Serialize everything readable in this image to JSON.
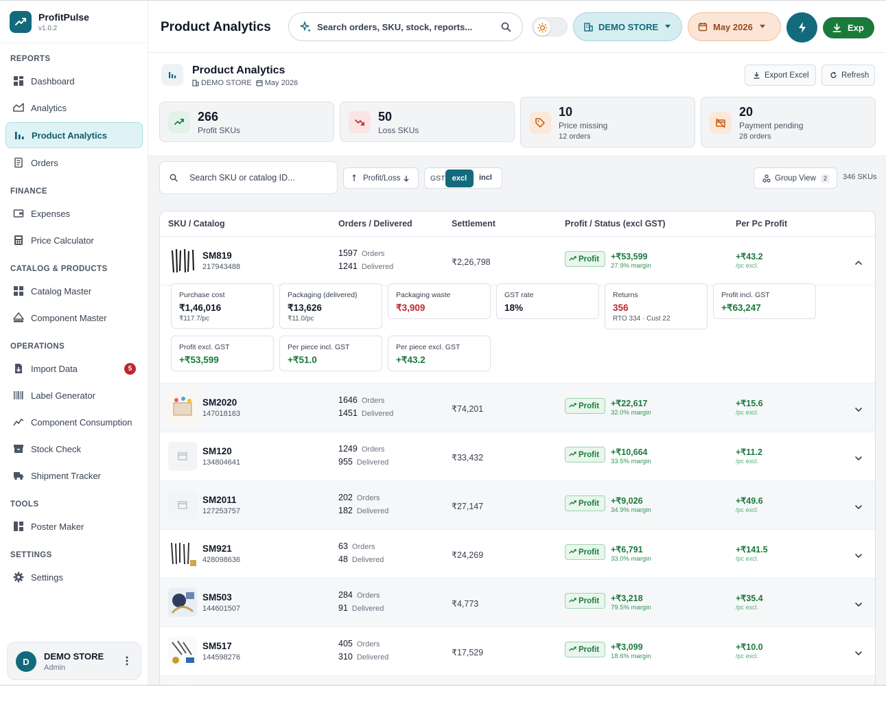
{
  "app": {
    "name": "ProfitPulse",
    "version": "v1.0.2"
  },
  "sidebar": {
    "sections": [
      {
        "title": "REPORTS",
        "items": [
          {
            "label": "Dashboard",
            "icon": "dashboard-icon"
          },
          {
            "label": "Analytics",
            "icon": "analytics-icon"
          },
          {
            "label": "Product Analytics",
            "icon": "bar-chart-icon",
            "active": true
          },
          {
            "label": "Orders",
            "icon": "orders-icon"
          }
        ]
      },
      {
        "title": "FINANCE",
        "items": [
          {
            "label": "Expenses",
            "icon": "wallet-icon"
          },
          {
            "label": "Price Calculator",
            "icon": "calculator-icon"
          }
        ]
      },
      {
        "title": "CATALOG & PRODUCTS",
        "items": [
          {
            "label": "Catalog Master",
            "icon": "grid-icon"
          },
          {
            "label": "Component Master",
            "icon": "layers-icon"
          }
        ]
      },
      {
        "title": "OPERATIONS",
        "items": [
          {
            "label": "Import Data",
            "icon": "file-icon",
            "badge": "5"
          },
          {
            "label": "Label Generator",
            "icon": "barcode-icon"
          },
          {
            "label": "Component Consumption",
            "icon": "trend-icon"
          },
          {
            "label": "Stock Check",
            "icon": "archive-icon"
          },
          {
            "label": "Shipment Tracker",
            "icon": "truck-icon"
          }
        ]
      },
      {
        "title": "TOOLS",
        "items": [
          {
            "label": "Poster Maker",
            "icon": "layout-icon"
          }
        ]
      },
      {
        "title": "SETTINGS",
        "items": [
          {
            "label": "Settings",
            "icon": "gear-icon"
          }
        ]
      }
    ],
    "user": {
      "initial": "D",
      "name": "DEMO STORE",
      "role": "Admin"
    }
  },
  "header": {
    "title": "Product Analytics",
    "search_placeholder": "Search orders, SKU, stock, reports...",
    "store": "DEMO STORE",
    "month": "May 2026",
    "export_label": "Exp"
  },
  "page": {
    "title": "Product Analytics",
    "store": "DEMO STORE",
    "month": "May 2026",
    "export_excel": "Export Excel",
    "refresh": "Refresh"
  },
  "stats": [
    {
      "value": "266",
      "label": "Profit SKUs",
      "sub": ""
    },
    {
      "value": "50",
      "label": "Loss SKUs",
      "sub": ""
    },
    {
      "value": "10",
      "label": "Price missing",
      "sub": "12 orders"
    },
    {
      "value": "20",
      "label": "Payment pending",
      "sub": "28 orders"
    }
  ],
  "filters": {
    "search_placeholder": "Search SKU or catalog ID...",
    "sort_label": "Profit/Loss",
    "gst_label": "GST",
    "gst_excl": "excl",
    "gst_incl": "incl",
    "group_view": "Group View",
    "group_count": "2",
    "sku_count": "346 SKUs"
  },
  "table": {
    "columns": [
      "SKU / Catalog",
      "Orders / Delivered",
      "Settlement",
      "Profit / Status (excl GST)",
      "Per Pc Profit"
    ],
    "orders_word": "Orders",
    "delivered_word": "Delivered",
    "status_label": "Profit",
    "per_pc_suffix": "/pc excl.",
    "rows": [
      {
        "sku": "SM819",
        "catalog": "217943488",
        "orders": "1597",
        "delivered": "1241",
        "settlement": "₹2,26,798",
        "profit": "+₹53,599",
        "margin": "27.9% margin",
        "per_pc": "+₹43.2",
        "expanded": true
      },
      {
        "sku": "SM2020",
        "catalog": "147018163",
        "orders": "1646",
        "delivered": "1451",
        "settlement": "₹74,201",
        "profit": "+₹22,617",
        "margin": "32.0% margin",
        "per_pc": "+₹15.6"
      },
      {
        "sku": "SM120",
        "catalog": "134804641",
        "orders": "1249",
        "delivered": "955",
        "settlement": "₹33,432",
        "profit": "+₹10,664",
        "margin": "33.5% margin",
        "per_pc": "+₹11.2"
      },
      {
        "sku": "SM2011",
        "catalog": "127253757",
        "orders": "202",
        "delivered": "182",
        "settlement": "₹27,147",
        "profit": "+₹9,026",
        "margin": "34.9% margin",
        "per_pc": "+₹49.6"
      },
      {
        "sku": "SM921",
        "catalog": "428098636",
        "orders": "63",
        "delivered": "48",
        "settlement": "₹24,269",
        "profit": "+₹6,791",
        "margin": "33.0% margin",
        "per_pc": "+₹141.5"
      },
      {
        "sku": "SM503",
        "catalog": "144601507",
        "orders": "284",
        "delivered": "91",
        "settlement": "₹4,773",
        "profit": "+₹3,218",
        "margin": "79.5% margin",
        "per_pc": "+₹35.4"
      },
      {
        "sku": "SM517",
        "catalog": "144598276",
        "orders": "405",
        "delivered": "310",
        "settlement": "₹17,529",
        "profit": "+₹3,099",
        "margin": "18.6% margin",
        "per_pc": "+₹10.0"
      }
    ],
    "details": [
      {
        "label": "Purchase cost",
        "value": "₹1,46,016",
        "sub": "₹117.7/pc",
        "tone": ""
      },
      {
        "label": "Packaging (delivered)",
        "value": "₹13,626",
        "sub": "₹11.0/pc",
        "tone": ""
      },
      {
        "label": "Packaging waste",
        "value": "₹3,909",
        "sub": "",
        "tone": "red"
      },
      {
        "label": "GST rate",
        "value": "18%",
        "sub": "",
        "tone": ""
      },
      {
        "label": "Returns",
        "value": "356",
        "sub": "RTO 334 · Cust 22",
        "tone": "red"
      },
      {
        "label": "Profit incl. GST",
        "value": "+₹63,247",
        "sub": "",
        "tone": "green"
      },
      {
        "label": "Profit excl. GST",
        "value": "+₹53,599",
        "sub": "",
        "tone": "green"
      },
      {
        "label": "Per piece incl. GST",
        "value": "+₹51.0",
        "sub": "",
        "tone": "green"
      },
      {
        "label": "Per piece excl. GST",
        "value": "+₹43.2",
        "sub": "",
        "tone": "green"
      }
    ]
  },
  "colors": {
    "brand": "#136a7d",
    "profit": "#1a7a3c",
    "loss": "#c0262d",
    "accent_orange": "#9a4a15"
  }
}
